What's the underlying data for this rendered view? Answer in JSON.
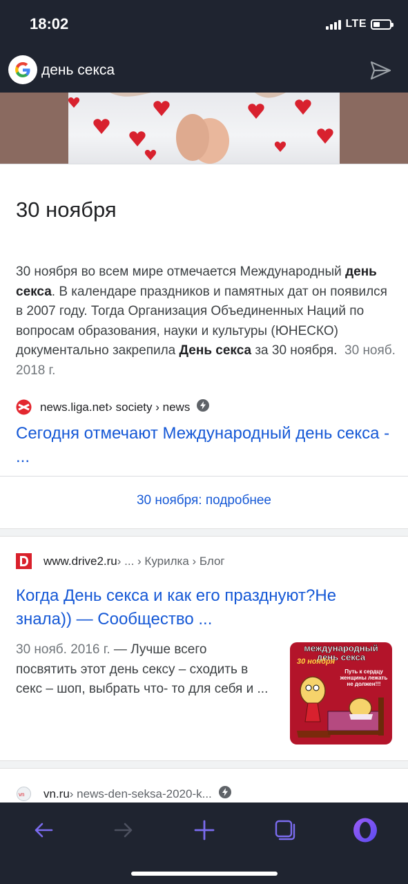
{
  "status": {
    "time": "18:02",
    "network": "LTE"
  },
  "search": {
    "query": "день секса"
  },
  "card1": {
    "date_title": "30 ноября",
    "snippet_parts": {
      "p1": "30 ноября во всем мире отмечается Международный ",
      "b1": "день секса",
      "p2": ". В календаре праздников и памятных дат он появился в 2007 году. Тогда Организация Объединенных Наций по вопросам образования, науки и культуры (ЮНЕСКО) документально закрепила ",
      "b2": "День секса",
      "p3": " за 30 ноября.",
      "date": "30 нояб. 2018 г."
    },
    "source": {
      "domain": "news.liga.net",
      "path": " › society › news"
    },
    "link": "Сегодня отмечают Международный день секса - ...",
    "more": "30 ноября: подробнее"
  },
  "card2": {
    "source": {
      "domain": "www.drive2.ru",
      "path": " › ... › Курилка › Блог"
    },
    "link": "Когда День секса и как его празднуют?Не знала)) — Сообщество ...",
    "date": "30 нояб. 2016 г.",
    "snippet": " — Лучше всего посвятить этот день сексу – сходить в секс – шоп, выбрать что- то для себя и ...",
    "thumb": {
      "title": "международный день секса",
      "date": "30 ноября",
      "subtitle": "Путь к сердцу женщины лежать не должен!!!"
    }
  },
  "card3": {
    "source": {
      "domain": "vn.ru",
      "path": " › news-den-seksa-2020-k..."
    }
  },
  "colors": {
    "bar_bg": "#1f2430",
    "link": "#1558d6",
    "nav_accent": "#7b6cf0"
  },
  "icons": [
    "google-icon",
    "send-icon",
    "amp-icon",
    "back-icon",
    "forward-icon",
    "add-icon",
    "tabs-icon",
    "opera-icon"
  ]
}
